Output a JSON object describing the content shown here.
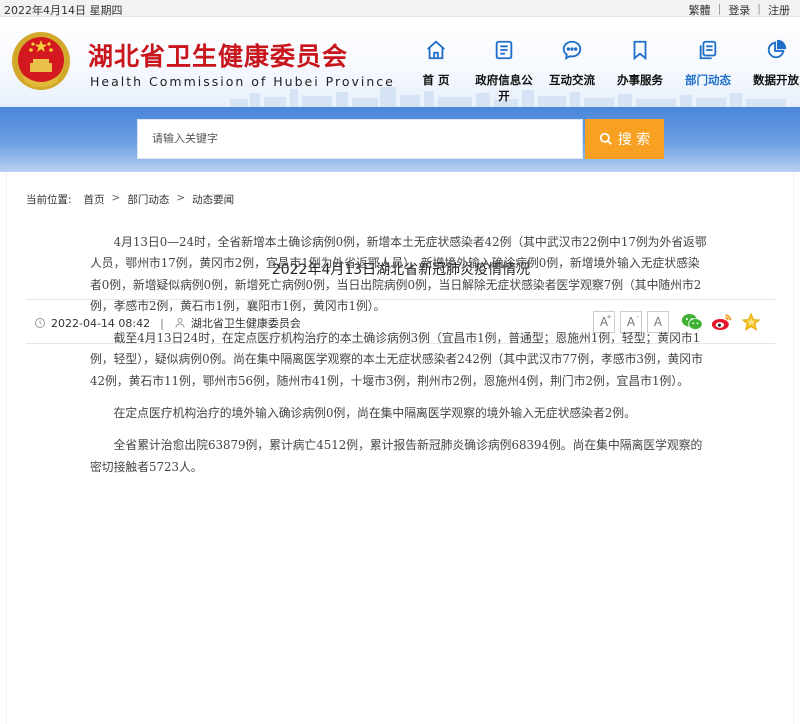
{
  "topbar": {
    "date": "2022年4月14日 星期四",
    "links": [
      "繁體",
      "登录",
      "注册"
    ]
  },
  "header": {
    "title": "湖北省卫生健康委员会",
    "subtitle": "Health Commission of Hubei Province",
    "nav": [
      {
        "label": "首 页",
        "icon": "home-icon"
      },
      {
        "label": "政府信息公开",
        "icon": "document-icon"
      },
      {
        "label": "互动交流",
        "icon": "chat-icon"
      },
      {
        "label": "办事服务",
        "icon": "bookmark-icon"
      },
      {
        "label": "部门动态",
        "icon": "copy-icon",
        "active": true
      },
      {
        "label": "数据开放",
        "icon": "pie-chart-icon"
      }
    ]
  },
  "search": {
    "placeholder": "请输入关键字",
    "button": "搜 索"
  },
  "breadcrumb": {
    "label": "当前位置:",
    "items": [
      "首页",
      "部门动态",
      "动态要闻"
    ]
  },
  "article": {
    "title": "2022年4月13日湖北省新冠肺炎疫情情况",
    "date": "2022-04-14 08:42",
    "source": "湖北省卫生健康委员会",
    "font_buttons": [
      "A",
      "A",
      "A"
    ],
    "share_icons": [
      "wechat-icon",
      "weibo-icon",
      "favorite-star-icon"
    ],
    "paragraphs": [
      "4月13日0—24时，全省新增本土确诊病例0例，新增本土无症状感染者42例（其中武汉市22例中17例为外省返鄂人员，鄂州市17例，黄冈市2例，宜昌市1例为外省返鄂人员），新增境外输入确诊病例0例，新增境外输入无症状感染者0例，新增疑似病例0例，新增死亡病例0例，当日出院病例0例，当日解除无症状感染者医学观察7例（其中随州市2例，孝感市2例，黄石市1例，襄阳市1例，黄冈市1例）。",
      "截至4月13日24时，在定点医疗机构治疗的本土确诊病例3例（宜昌市1例，普通型；恩施州1例，轻型；黄冈市1例，轻型），疑似病例0例。尚在集中隔离医学观察的本土无症状感染者242例（其中武汉市77例，孝感市3例，黄冈市42例，黄石市11例，鄂州市56例，随州市41例，十堰市3例，荆州市2例，恩施州4例，荆门市2例，宜昌市1例）。",
      "在定点医疗机构治疗的境外输入确诊病例0例，尚在集中隔离医学观察的境外输入无症状感染者2例。",
      "全省累计治愈出院63879例，累计病亡4512例，累计报告新冠肺炎确诊病例68394例。尚在集中隔离医学观察的密切接触者5723人。"
    ]
  },
  "colors": {
    "brand_red": "#c8161d",
    "nav_active": "#1f6fc9",
    "search_button": "#f7a021",
    "band_blue": "#4a86da"
  }
}
